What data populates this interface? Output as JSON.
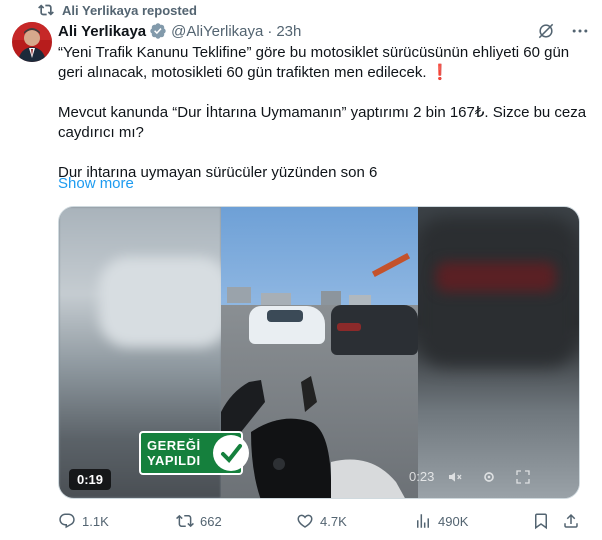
{
  "repost": {
    "label": "Ali Yerlikaya reposted"
  },
  "author": {
    "name": "Ali Yerlikaya",
    "handle": "@AliYerlikaya",
    "separator": "·",
    "time": "23h"
  },
  "tweet": {
    "line1": "“Yeni Trafik Kanunu Teklifine” göre bu motosiklet sürücüsünün ehliyeti 60 gün",
    "line2": "geri alınacak, motosikleti 60 gün trafikten men edilecek. ❗",
    "line3": "Mevcut kanunda “Dur İhtarına Uymamanın” yaptırımı 2 bin 167₺. Sizce bu ceza",
    "line4": "caydırıcı mı?",
    "line5": "Dur ihtarına uymayan sürücüler yüzünden son 6",
    "show_more": "Show more"
  },
  "media": {
    "badge_line1": "GEREĞİ",
    "badge_line2": "YAPILDI",
    "timer": "0:19",
    "overlay_time": "0:23"
  },
  "actions": {
    "replies": "1.1K",
    "reposts": "662",
    "likes": "4.7K",
    "views": "490K"
  },
  "colors": {
    "link": "#1d9bf0",
    "muted": "#536471",
    "repost_green": "#00ba7c",
    "verified": "#829aab",
    "badge_green": "#15803d"
  }
}
